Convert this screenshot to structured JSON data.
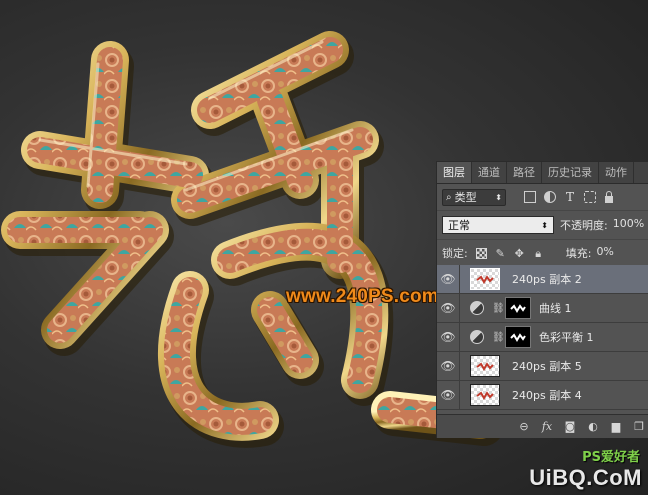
{
  "panel": {
    "tabs": [
      "图层",
      "通道",
      "路径",
      "历史记录",
      "动作"
    ],
    "active_tab": "图层",
    "filter": {
      "kind_label": "类型",
      "icons": [
        "pixel-filter-icon",
        "adjustment-filter-icon",
        "type-filter-icon",
        "shape-filter-icon",
        "smart-object-filter-icon"
      ]
    },
    "blend_mode": "正常",
    "opacity_label": "不透明度:",
    "opacity_value": "100%",
    "lock_label": "锁定:",
    "fill_label": "填充:",
    "fill_value": "0%",
    "layers": [
      {
        "name": "240ps 副本 2",
        "kind": "pixel",
        "selected": true
      },
      {
        "name": "曲线 1",
        "kind": "adjustment",
        "selected": false
      },
      {
        "name": "色彩平衡 1",
        "kind": "adjustment",
        "selected": false
      },
      {
        "name": "240ps 副本 5",
        "kind": "pixel",
        "selected": false
      },
      {
        "name": "240ps 副本 4",
        "kind": "pixel",
        "selected": false
      }
    ],
    "bottom_icons": [
      "link-icon",
      "fx-icon",
      "mask-icon",
      "new-adjustment-icon",
      "folder-icon",
      "new-layer-icon"
    ]
  },
  "watermark": "www.240PS.com",
  "site": {
    "logo": "UiBQ.CoM",
    "cn": "PS爱好者"
  },
  "colors": {
    "gold": "#d8b45a",
    "copper": "#c87a56",
    "teal": "#3fa6a0",
    "watermark": "#f08a1a"
  }
}
